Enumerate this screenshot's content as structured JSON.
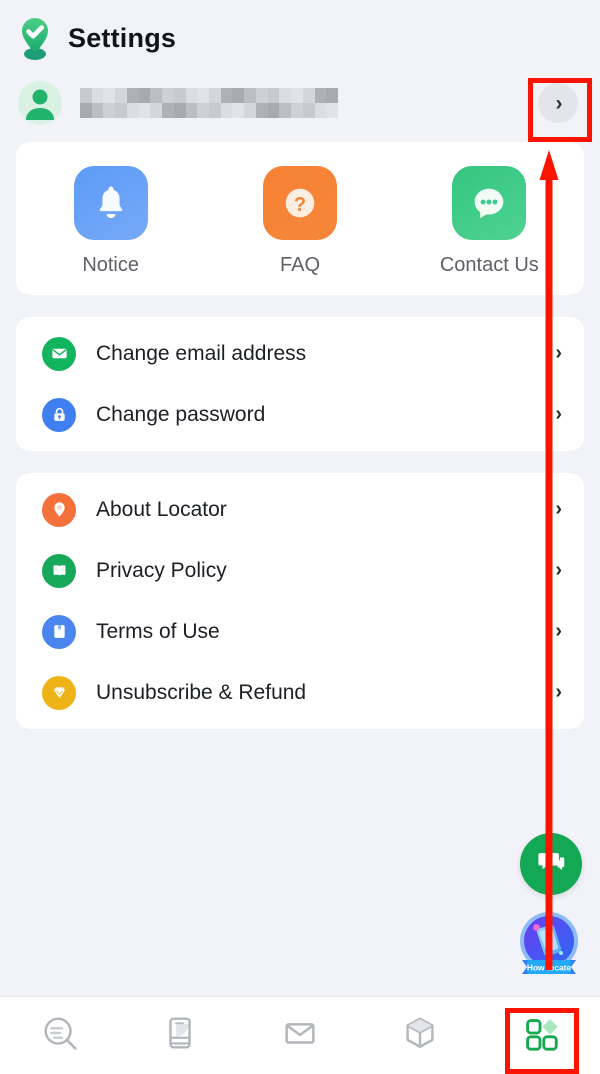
{
  "header": {
    "title": "Settings",
    "logo_icon": "location-pin-check-icon"
  },
  "account": {
    "avatar_icon": "user-avatar-icon",
    "name_redacted": true,
    "chevron_icon": "chevron-right-icon"
  },
  "quick_actions": [
    {
      "label": "Notice",
      "icon": "bell-icon",
      "color": "#5c9cf6"
    },
    {
      "label": "FAQ",
      "icon": "question-mark-icon",
      "color": "#f78134"
    },
    {
      "label": "Contact Us",
      "icon": "chat-bubble-icon",
      "color": "#35c57f"
    }
  ],
  "account_settings": [
    {
      "label": "Change email address",
      "icon": "mail-icon",
      "color": "#12b45e",
      "arrow": "›"
    },
    {
      "label": "Change password",
      "icon": "lock-icon",
      "color": "#3f7ff0",
      "arrow": "›"
    }
  ],
  "info_settings": [
    {
      "label": "About Locator",
      "icon": "location-pin-icon",
      "color": "#f4713c",
      "arrow": "›"
    },
    {
      "label": "Privacy Policy",
      "icon": "book-icon",
      "color": "#17a85a",
      "arrow": "›"
    },
    {
      "label": "Terms of Use",
      "icon": "bookmark-icon",
      "color": "#4a85f0",
      "arrow": "›"
    },
    {
      "label": "Unsubscribe & Refund",
      "icon": "diamond-icon",
      "color": "#eeb316",
      "arrow": "›"
    }
  ],
  "floating": {
    "chat_icon": "chat-support-icon",
    "badge_label": "How locate",
    "badge_icon": "how-locate-badge-icon"
  },
  "bottom_nav": [
    {
      "icon": "search-locate-icon",
      "active": false
    },
    {
      "icon": "device-phone-icon",
      "active": false
    },
    {
      "icon": "mail-icon",
      "active": false
    },
    {
      "icon": "cube-icon",
      "active": false
    },
    {
      "icon": "grid-apps-icon",
      "active": true
    }
  ],
  "annotations": {
    "accent_color": "#fb1400",
    "arrow_icon": "up-arrow-annotation",
    "highlight_top": "account-chevron-button",
    "highlight_bottom": "nav-item-grid-apps"
  }
}
